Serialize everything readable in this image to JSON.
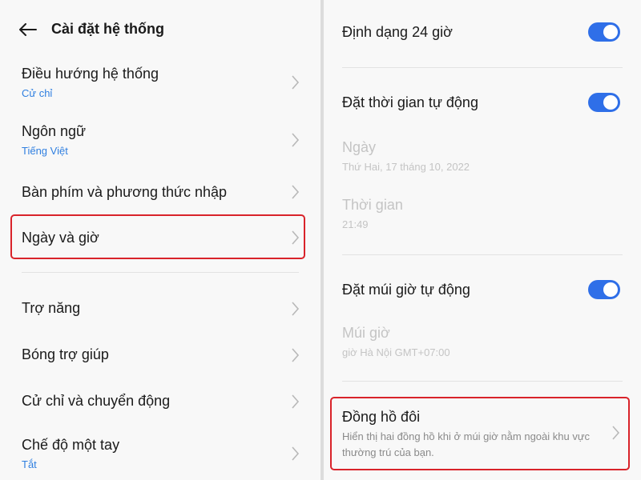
{
  "left": {
    "title": "Cài đặt hệ thống",
    "items": [
      {
        "label": "Điều hướng hệ thống",
        "sub": "Cử chỉ"
      },
      {
        "label": "Ngôn ngữ",
        "sub": "Tiếng Việt"
      },
      {
        "label": "Bàn phím và phương thức nhập",
        "sub": ""
      },
      {
        "label": "Ngày và giờ",
        "sub": ""
      },
      {
        "label": "Trợ năng",
        "sub": ""
      },
      {
        "label": "Bóng trợ giúp",
        "sub": ""
      },
      {
        "label": "Cử chỉ và chuyển động",
        "sub": ""
      },
      {
        "label": "Chế độ một tay",
        "sub": "Tắt"
      }
    ]
  },
  "right": {
    "format_24h": {
      "label": "Định dạng 24 giờ",
      "on": true
    },
    "auto_time": {
      "label": "Đặt thời gian tự động",
      "on": true
    },
    "date": {
      "label": "Ngày",
      "value": "Thứ Hai, 17 tháng 10, 2022"
    },
    "time": {
      "label": "Thời gian",
      "value": "21:49"
    },
    "auto_timezone": {
      "label": "Đặt múi giờ tự động",
      "on": true
    },
    "timezone": {
      "label": "Múi giờ",
      "value": "giờ Hà Nội GMT+07:00"
    },
    "dual_clock": {
      "label": "Đồng hồ đôi",
      "desc": "Hiển thị hai đồng hồ khi ở múi giờ nằm ngoài khu vực thường trú của bạn."
    }
  },
  "colors": {
    "accent": "#2f6fe8",
    "highlight": "#d9232a",
    "link": "#2f7fe0"
  }
}
